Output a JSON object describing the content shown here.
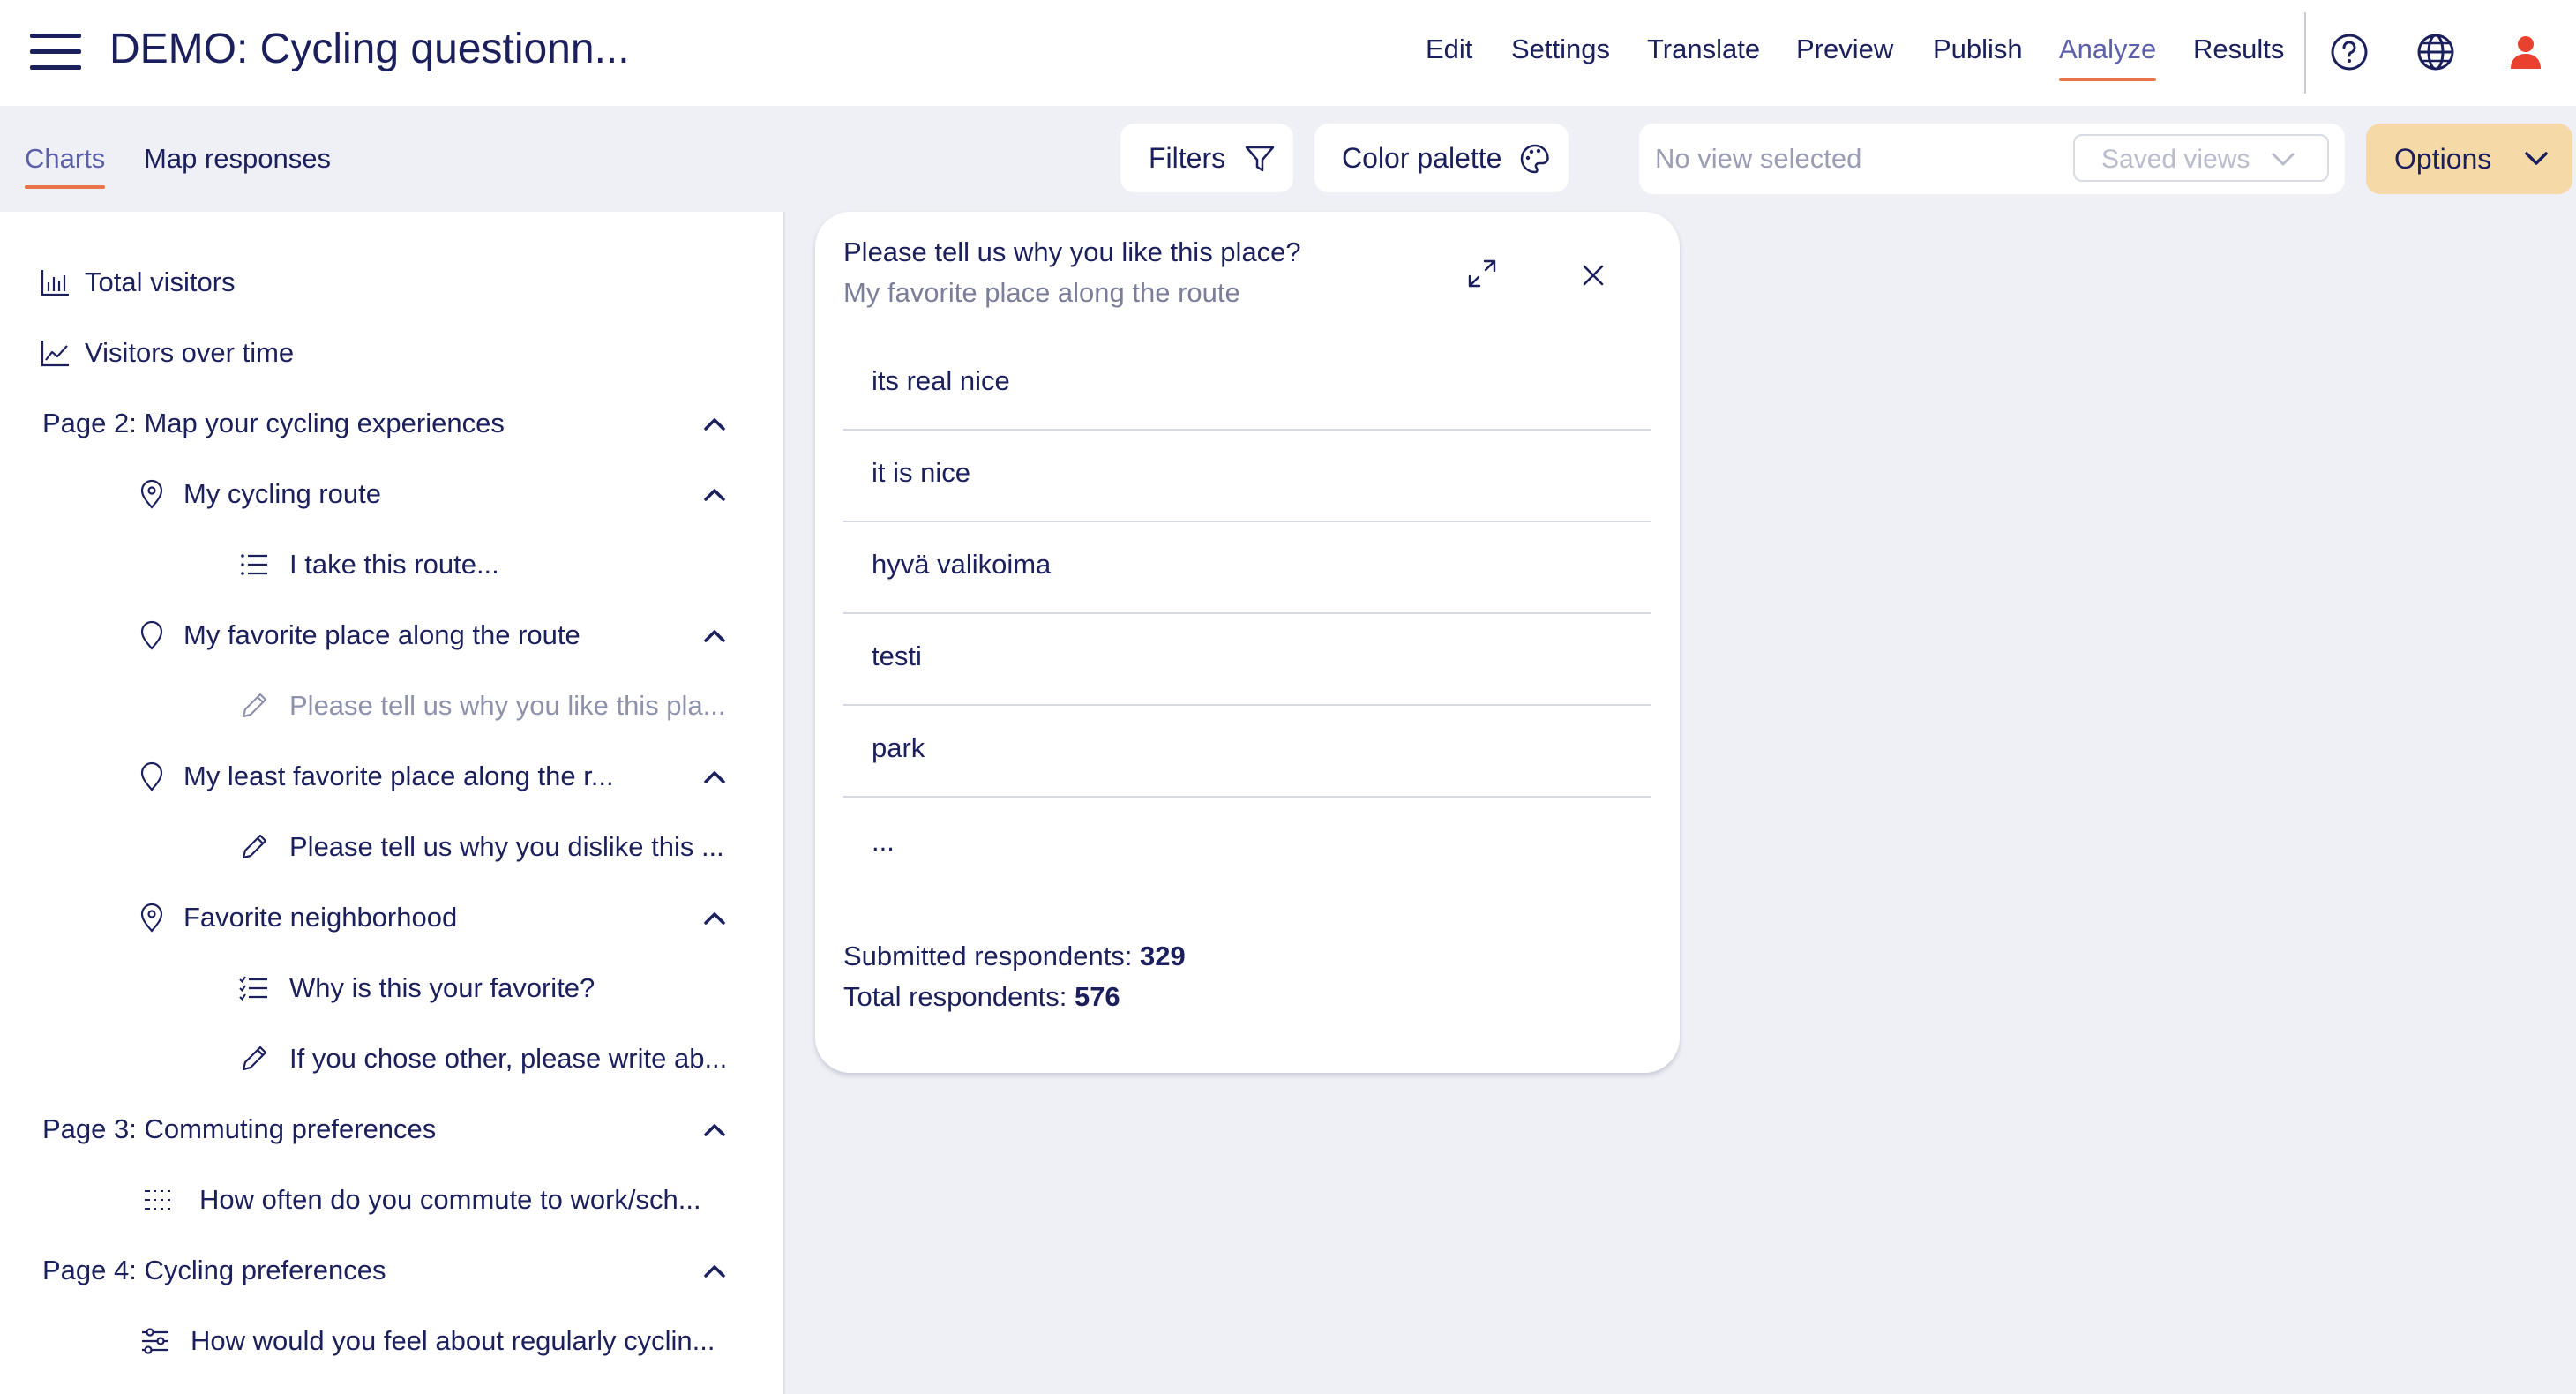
{
  "header": {
    "title": "DEMO: Cycling questionn...",
    "nav": [
      "Edit",
      "Settings",
      "Translate",
      "Preview",
      "Publish",
      "Analyze",
      "Results"
    ],
    "active_nav": "Analyze"
  },
  "toolbar": {
    "tabs": [
      "Charts",
      "Map responses"
    ],
    "filters_label": "Filters",
    "color_palette_label": "Color palette",
    "view_placeholder": "No view selected",
    "saved_views_label": "Saved views",
    "options_label": "Options"
  },
  "sidebar": {
    "items": [
      {
        "label": "Total visitors",
        "icon": "bar-chart-icon"
      },
      {
        "label": "Visitors over time",
        "icon": "line-chart-icon"
      },
      {
        "label": "Page 2: Map your cycling experiences"
      },
      {
        "label": "My cycling route",
        "icon": "map-pin-icon"
      },
      {
        "label": "I take this route...",
        "icon": "list-icon"
      },
      {
        "label": "My favorite place along the route",
        "icon": "map-pin-icon"
      },
      {
        "label": "Please tell us why you like this pla...",
        "icon": "pencil-icon"
      },
      {
        "label": "My least favorite place along the r...",
        "icon": "map-pin-icon"
      },
      {
        "label": "Please tell us why you dislike this ...",
        "icon": "pencil-icon"
      },
      {
        "label": "Favorite neighborhood",
        "icon": "map-pin-icon"
      },
      {
        "label": "Why is this your favorite?",
        "icon": "checklist-icon"
      },
      {
        "label": "If you chose other, please write ab...",
        "icon": "pencil-icon"
      },
      {
        "label": "Page 3: Commuting preferences"
      },
      {
        "label": "How often do you commute to work/sch...",
        "icon": "grid-icon"
      },
      {
        "label": "Page 4: Cycling preferences"
      },
      {
        "label": "How would you feel about regularly cyclin...",
        "icon": "sliders-icon"
      }
    ]
  },
  "card": {
    "title": "Please tell us why you like this place?",
    "subtitle": "My favorite place along the route",
    "answers": [
      "its real nice",
      "it is nice",
      "hyvä valikoima",
      "testi",
      "park"
    ],
    "more": "...",
    "submitted_label": "Submitted respondents: ",
    "submitted_value": "329",
    "total_label": "Total respondents: ",
    "total_value": "576"
  },
  "colors": {
    "primary_text": "#1b1f5c",
    "active_tab": "#5b5fa8",
    "accent_underline": "#e8734a",
    "options_button": "#f5d9a6",
    "user_icon": "#e8412e",
    "background": "#eef0f5"
  }
}
